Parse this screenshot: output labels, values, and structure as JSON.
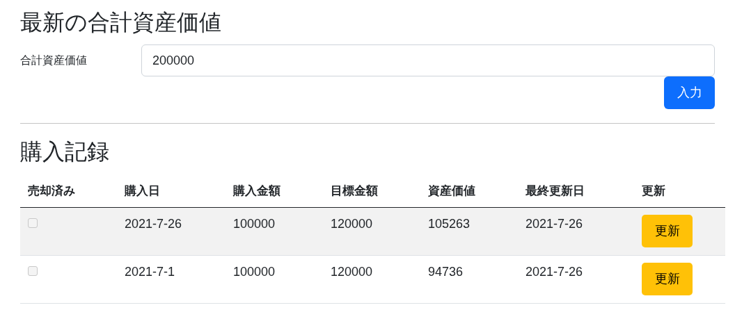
{
  "total_section": {
    "title": "最新の合計資産価値",
    "label": "合計資産価値",
    "value": "200000",
    "submit": "入力"
  },
  "records": {
    "title": "購入記録",
    "columns": [
      "売却済み",
      "購入日",
      "購入金額",
      "目標金額",
      "資産価値",
      "最終更新日",
      "更新"
    ],
    "rows": [
      {
        "sold": {
          "checked": false,
          "disabled": true
        },
        "purchase_date": "2021-7-26",
        "purchase_amount": "100000",
        "target_amount": "120000",
        "asset_value": "105263",
        "last_updated": "2021-7-26",
        "update_button": "更新"
      },
      {
        "sold": {
          "checked": false,
          "disabled": true
        },
        "purchase_date": "2021-7-1",
        "purchase_amount": "100000",
        "target_amount": "120000",
        "asset_value": "94736",
        "last_updated": "2021-7-26",
        "update_button": "更新"
      }
    ]
  }
}
